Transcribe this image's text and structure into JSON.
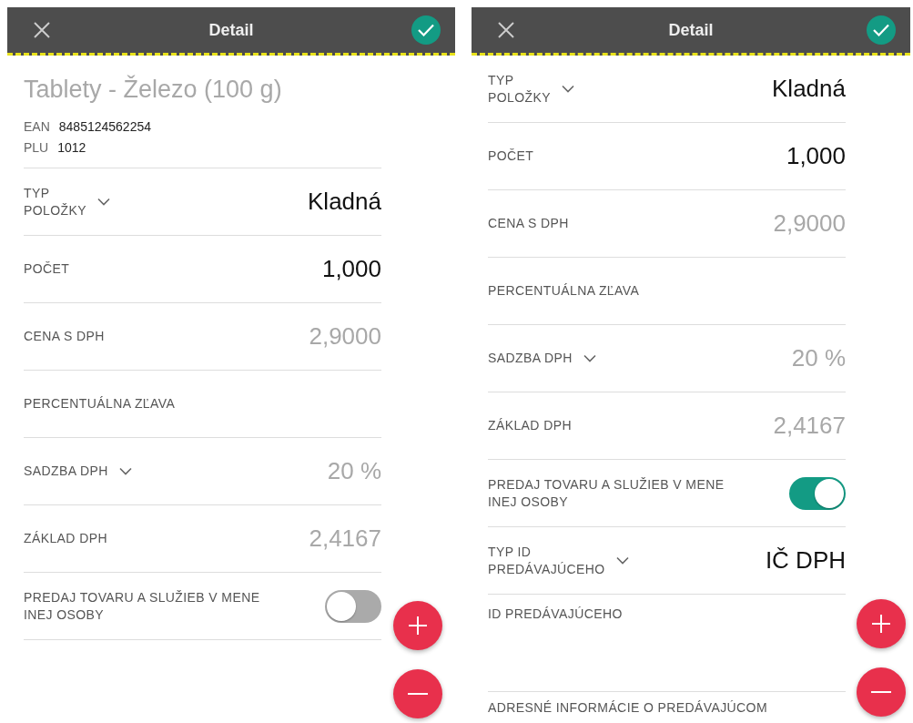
{
  "screens": [
    {
      "title": "Detail",
      "product": {
        "name": "Tablety - Železo (100 g)",
        "codes": [
          {
            "label": "EAN",
            "value": "8485124562254"
          },
          {
            "label": "PLU",
            "value": "1012"
          }
        ]
      },
      "fields": [
        {
          "kind": "select",
          "label": "TYP\nPOLOŽKY",
          "value": "Kladná",
          "muted": false
        },
        {
          "kind": "value",
          "label": "POČET",
          "value": "1,000",
          "muted": false
        },
        {
          "kind": "value",
          "label": "CENA S DPH",
          "value": "2,9000",
          "muted": true
        },
        {
          "kind": "empty",
          "label": "PERCENTUÁLNA ZĽAVA"
        },
        {
          "kind": "select",
          "label": "SADZBA DPH",
          "value": "20 %",
          "muted": true
        },
        {
          "kind": "value",
          "label": "ZÁKLAD DPH",
          "value": "2,4167",
          "muted": true
        },
        {
          "kind": "toggle",
          "label": "PREDAJ TOVARU A SLUŽIEB V MENE\nINEJ OSOBY",
          "on": false
        }
      ]
    },
    {
      "title": "Detail",
      "fields": [
        {
          "kind": "select",
          "label": "TYP\nPOLOŽKY",
          "value": "Kladná",
          "muted": false
        },
        {
          "kind": "value",
          "label": "POČET",
          "value": "1,000",
          "muted": false
        },
        {
          "kind": "value",
          "label": "CENA S DPH",
          "value": "2,9000",
          "muted": true
        },
        {
          "kind": "empty",
          "label": "PERCENTUÁLNA ZĽAVA"
        },
        {
          "kind": "select",
          "label": "SADZBA DPH",
          "value": "20 %",
          "muted": true
        },
        {
          "kind": "value",
          "label": "ZÁKLAD DPH",
          "value": "2,4167",
          "muted": true
        },
        {
          "kind": "toggle",
          "label": "PREDAJ TOVARU A SLUŽIEB V MENE\nINEJ OSOBY",
          "on": true
        },
        {
          "kind": "select",
          "label": "TYP ID\nPREDÁVAJÚCEHO",
          "value": "IČ DPH",
          "muted": false
        },
        {
          "kind": "textarea",
          "label": "ID PREDÁVAJÚCEHO"
        },
        {
          "kind": "empty",
          "label": "ADRESNÉ INFORMÁCIE O PREDÁVAJÚCOM"
        }
      ]
    }
  ]
}
